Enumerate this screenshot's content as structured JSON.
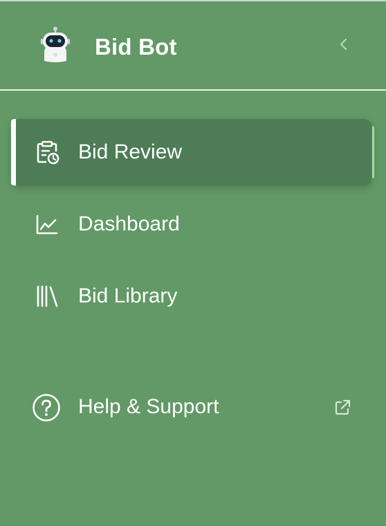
{
  "app": {
    "title": "Bid Bot"
  },
  "nav": {
    "items": [
      {
        "label": "Bid Review",
        "icon": "clipboard-clock-icon",
        "active": true
      },
      {
        "label": "Dashboard",
        "icon": "line-chart-icon",
        "active": false
      },
      {
        "label": "Bid Library",
        "icon": "library-books-icon",
        "active": false
      }
    ]
  },
  "help": {
    "label": "Help & Support",
    "icon": "question-circle-icon",
    "external_icon": "external-link-icon"
  },
  "colors": {
    "sidebar_bg": "#629966",
    "active_bg": "#4d7c56",
    "active_accent": "#a8dca4",
    "text": "#ffffff"
  }
}
